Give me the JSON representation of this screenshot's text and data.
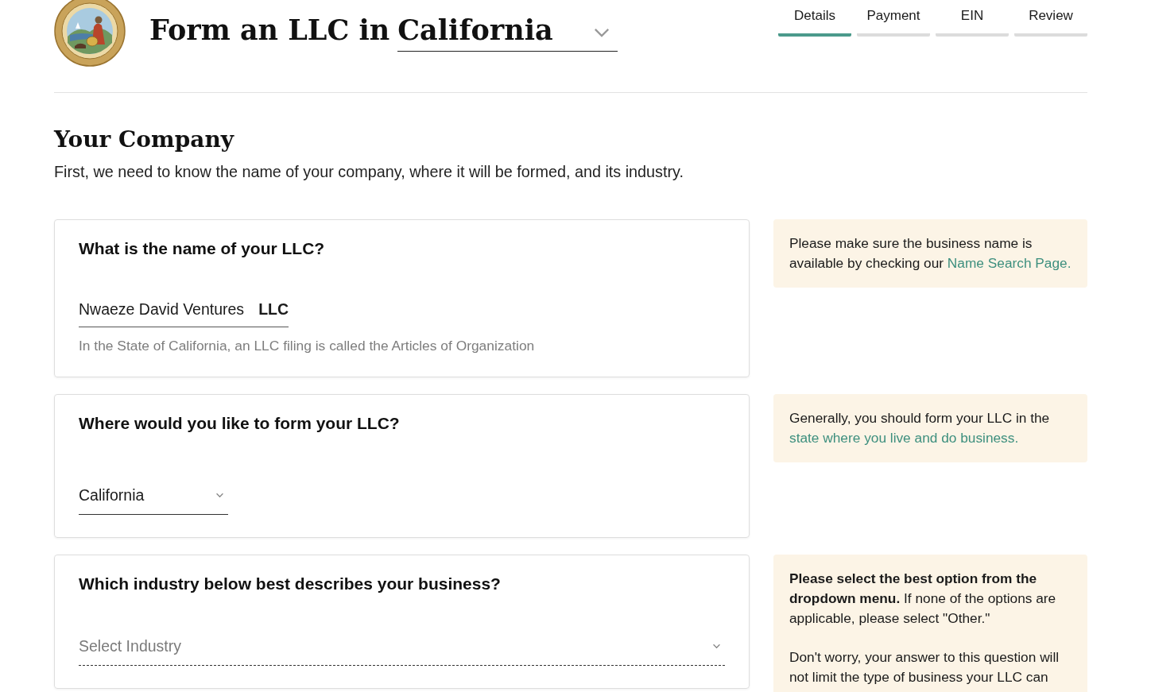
{
  "header": {
    "title": "Form an LLC in",
    "state_select": {
      "value": "California"
    }
  },
  "steps": [
    {
      "label": "Details",
      "selected": true
    },
    {
      "label": "Payment",
      "selected": false
    },
    {
      "label": "EIN",
      "selected": false
    },
    {
      "label": "Review",
      "selected": false
    }
  ],
  "section": {
    "title": "Your Company",
    "description": "First, we need to know the name of your company, where it will be formed, and its industry."
  },
  "questions": [
    {
      "question": "What is the name of your LLC?",
      "field": {
        "kind": "text",
        "value": "Nwaeze David Ventures",
        "suffix": "LLC"
      },
      "hint": "In the State of California, an LLC filing is called the Articles of Organization",
      "tip": [
        {
          "text": "Please make sure the business name is available by checking our ",
          "link": "Name Search Page."
        }
      ]
    },
    {
      "question": "Where would you like to form your LLC?",
      "field": {
        "kind": "select",
        "value": "California"
      },
      "tip": [
        {
          "text": "Generally, you should form your LLC in the ",
          "link": "state where you live and do business."
        }
      ]
    },
    {
      "question": "Which industry below best describes your business?",
      "field": {
        "kind": "select",
        "placeholder": "Select Industry"
      },
      "tip": [
        {
          "text": "**Please select the best option from the dropdown menu.** If none of the options are applicable, please select \"Other.\""
        },
        {
          "text": "Don't worry, your answer to this question will not limit the type of business your LLC can"
        }
      ]
    }
  ]
}
